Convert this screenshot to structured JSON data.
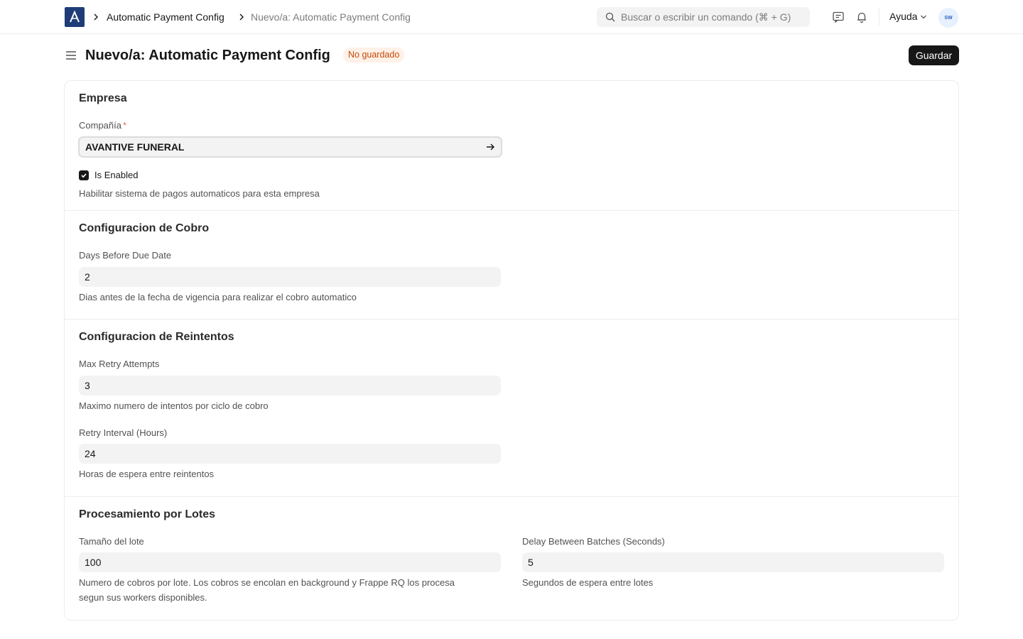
{
  "navbar": {
    "breadcrumbs": [
      "Automatic Payment Config",
      "Nuevo/a: Automatic Payment Config"
    ],
    "search_placeholder": "Buscar o escribir un comando (⌘ + G)",
    "help_label": "Ayuda",
    "avatar_initials": "SW"
  },
  "page": {
    "title": "Nuevo/a: Automatic Payment Config",
    "status_badge": "No guardado",
    "save_label": "Guardar"
  },
  "sections": {
    "empresa": {
      "title": "Empresa",
      "company_label": "Compañía",
      "company_required": "*",
      "company_value": "AVANTIVE FUNERAL",
      "enabled_label": "Is Enabled",
      "enabled_checked": true,
      "enabled_desc": "Habilitar sistema de pagos automaticos para esta empresa"
    },
    "cobro": {
      "title": "Configuracion de Cobro",
      "days_label": "Days Before Due Date",
      "days_value": "2",
      "days_desc": "Dias antes de la fecha de vigencia para realizar el cobro automatico"
    },
    "reintentos": {
      "title": "Configuracion de Reintentos",
      "max_label": "Max Retry Attempts",
      "max_value": "3",
      "max_desc": "Maximo numero de intentos por ciclo de cobro",
      "interval_label": "Retry Interval (Hours)",
      "interval_value": "24",
      "interval_desc": "Horas de espera entre reintentos"
    },
    "lotes": {
      "title": "Procesamiento por Lotes",
      "size_label": "Tamaño del lote",
      "size_value": "100",
      "size_desc_1": "Numero de cobros por lote. Los cobros se encolan en background y Frappe RQ los procesa",
      "size_desc_2": "segun sus workers disponibles.",
      "delay_label": "Delay Between Batches (Seconds)",
      "delay_value": "5",
      "delay_desc": "Segundos de espera entre lotes"
    }
  },
  "colors": {
    "brand": "#1f3c78",
    "badge_bg": "#fff1e7",
    "badge_text": "#c4480a",
    "primary_button": "#171717"
  }
}
